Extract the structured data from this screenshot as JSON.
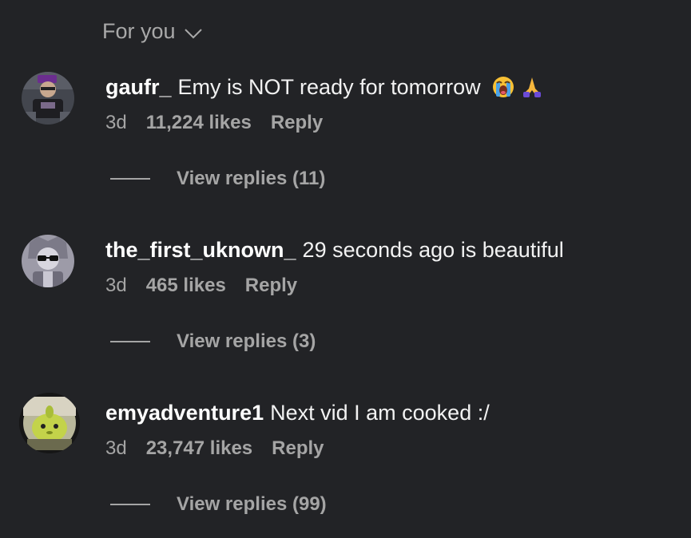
{
  "header": {
    "sort_label": "For you",
    "sort_icon": "chevron-down-icon"
  },
  "comments": [
    {
      "username": "gaufr_",
      "text": "Emy is NOT ready for tomorrow",
      "emojis": [
        "loudly-crying-face",
        "folded-hands"
      ],
      "age": "3d",
      "likes": "11,224 likes",
      "reply": "Reply",
      "view_replies": "View replies (11)",
      "avatar_colors": {
        "bg": "#3b3d45",
        "accent": "#6b2d8f"
      }
    },
    {
      "username": "the_first_uknown_",
      "text": "29 seconds ago is beautiful",
      "emojis": [],
      "age": "3d",
      "likes": "465 likes",
      "reply": "Reply",
      "view_replies": "View replies (3)",
      "avatar_colors": {
        "bg": "#8e8c99",
        "accent": "#1c1c22"
      }
    },
    {
      "username": "emyadventure1",
      "text": "Next vid I am cooked :/",
      "emojis": [],
      "age": "3d",
      "likes": "23,747 likes",
      "reply": "Reply",
      "view_replies": "View replies (99)",
      "avatar_colors": {
        "bg": "#9fa06b",
        "accent": "#c9d24a"
      }
    }
  ]
}
